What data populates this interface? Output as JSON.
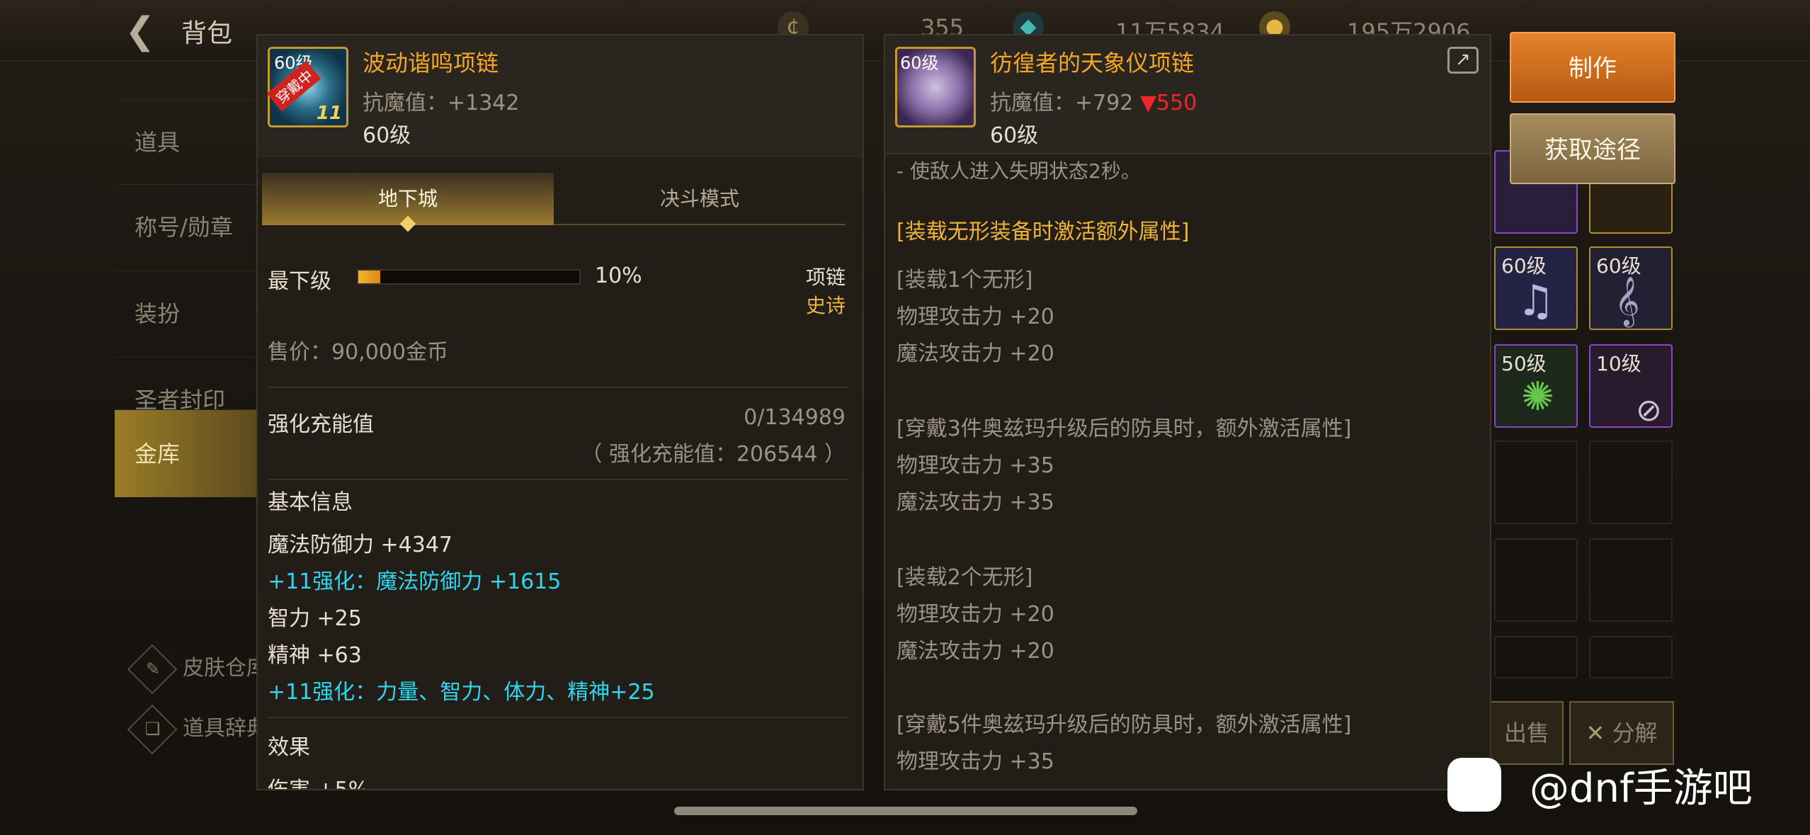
{
  "topbar": {
    "title": "背包",
    "currency_1": "355",
    "currency_2": "11万5834",
    "currency_3": "195万2906"
  },
  "sidebar": {
    "items": [
      {
        "label": "道具"
      },
      {
        "label": "称号/勋章"
      },
      {
        "label": "装扮"
      },
      {
        "label": "圣者封印"
      },
      {
        "label": "金库"
      }
    ],
    "tools": [
      {
        "label": "皮肤仓库"
      },
      {
        "label": "道具辞典"
      }
    ]
  },
  "inventory": {
    "slots": [
      {
        "level": "60级"
      },
      {
        "level": "60级"
      },
      {
        "level": "60级"
      },
      {
        "level": "50级"
      },
      {
        "level": "10级"
      }
    ],
    "sell_label": "出售",
    "decompose_label": "分解"
  },
  "actions": {
    "make_label": "制作",
    "source_label": "获取途径"
  },
  "left_item": {
    "level_badge": "60级",
    "equipped_badge": "穿戴中",
    "reinforce_badge": "11",
    "name": "波动谐鸣项链",
    "magic_resist": "抗魔值：+1342",
    "level": "60级",
    "tabs": [
      "地下城",
      "决斗模式"
    ],
    "grade_label": "最下级",
    "grade_percent": "10%",
    "grade_fill": 0.1,
    "slot_type": "项链",
    "rarity": "史诗",
    "price": "售价：90,000金币",
    "charge_title": "强化充能值",
    "charge_value": "0/134989",
    "charge_total": "（ 强化充能值：206544 ）",
    "basic_title": "基本信息",
    "stats": [
      {
        "text": "魔法防御力 +4347",
        "type": "normal"
      },
      {
        "text": "+11强化：魔法防御力 +1615",
        "type": "cyan"
      },
      {
        "text": "智力 +25",
        "type": "normal"
      },
      {
        "text": "精神 +63",
        "type": "normal"
      },
      {
        "text": "+11强化：力量、智力、体力、精神+25",
        "type": "cyan"
      }
    ],
    "effect_title": "效果",
    "effect_partial": "伤害 +5%"
  },
  "right_item": {
    "level_badge": "60级",
    "name": "彷徨者的天象仪项链",
    "magic_resist": "抗魔值：+792",
    "diff": "▼550",
    "level": "60级",
    "cut_line": "- 使敌人进入失明状态2秒。",
    "lines": [
      {
        "text": "[装载无形装备时激活额外属性]",
        "type": "gold"
      },
      {
        "text": "[装载1个无形]",
        "type": "dim"
      },
      {
        "text": "物理攻击力 +20",
        "type": "dim"
      },
      {
        "text": "魔法攻击力 +20",
        "type": "dim"
      },
      {
        "text": "[穿戴3件奥兹玛升级后的防具时，额外激活属性]",
        "type": "dim"
      },
      {
        "text": "物理攻击力 +35",
        "type": "dim"
      },
      {
        "text": "魔法攻击力 +35",
        "type": "dim"
      },
      {
        "text": "[装载2个无形]",
        "type": "dim"
      },
      {
        "text": "物理攻击力 +20",
        "type": "dim"
      },
      {
        "text": "魔法攻击力 +20",
        "type": "dim"
      },
      {
        "text": "[穿戴5件奥兹玛升级后的防具时，额外激活属性]",
        "type": "dim"
      },
      {
        "text": "物理攻击力 +35",
        "type": "dim"
      }
    ]
  },
  "watermark": {
    "text": "@dnf手游吧",
    "logo_text": "贴"
  }
}
